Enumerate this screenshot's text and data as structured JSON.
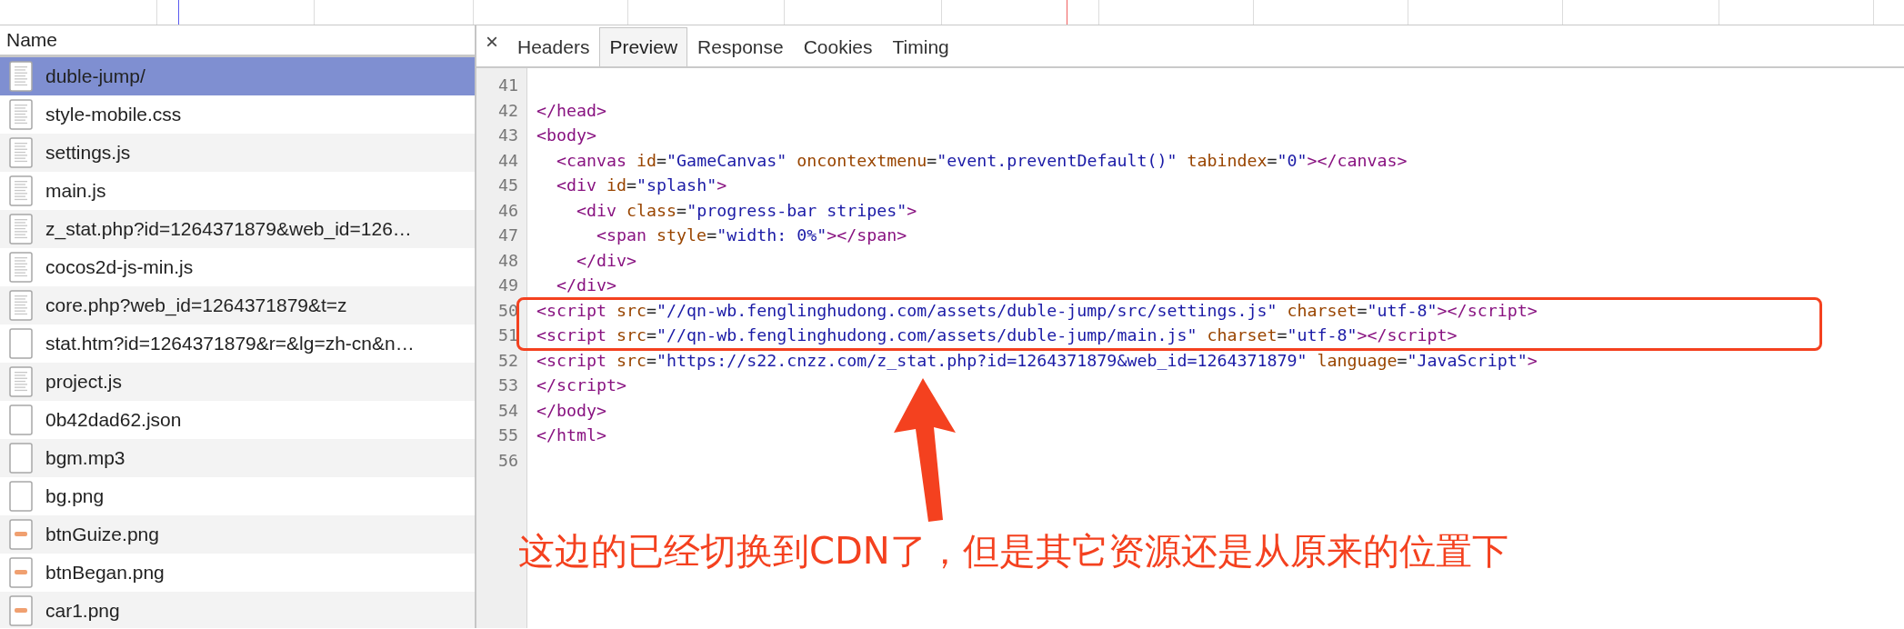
{
  "requests": {
    "column": "Name",
    "items": [
      {
        "name": "duble-jump/",
        "kind": "document",
        "selected": true
      },
      {
        "name": "style-mobile.css",
        "kind": "document",
        "selected": false
      },
      {
        "name": "settings.js",
        "kind": "document",
        "selected": false
      },
      {
        "name": "main.js",
        "kind": "document",
        "selected": false
      },
      {
        "name": "z_stat.php?id=1264371879&web_id=126…",
        "kind": "document",
        "selected": false
      },
      {
        "name": "cocos2d-js-min.js",
        "kind": "document",
        "selected": false
      },
      {
        "name": "core.php?web_id=1264371879&t=z",
        "kind": "document",
        "selected": false
      },
      {
        "name": "stat.htm?id=1264371879&r=&lg=zh-cn&n…",
        "kind": "blank",
        "selected": false
      },
      {
        "name": "project.js",
        "kind": "document",
        "selected": false
      },
      {
        "name": "0b42dad62.json",
        "kind": "blank",
        "selected": false
      },
      {
        "name": "bgm.mp3",
        "kind": "blank",
        "selected": false
      },
      {
        "name": "bg.png",
        "kind": "blank",
        "selected": false
      },
      {
        "name": "btnGuize.png",
        "kind": "image",
        "selected": false
      },
      {
        "name": "btnBegan.png",
        "kind": "image",
        "selected": false
      },
      {
        "name": "car1.png",
        "kind": "image",
        "selected": false
      }
    ]
  },
  "tabs": {
    "close": "×",
    "items": [
      {
        "label": "Headers",
        "selected": false
      },
      {
        "label": "Preview",
        "selected": true
      },
      {
        "label": "Response",
        "selected": false
      },
      {
        "label": "Cookies",
        "selected": false
      },
      {
        "label": "Timing",
        "selected": false
      }
    ]
  },
  "code_lines": [
    {
      "number": "41"
    },
    {
      "number": "42",
      "tokens": [
        {
          "kind": "tag",
          "text": "</head>"
        }
      ]
    },
    {
      "number": "43",
      "tokens": [
        {
          "kind": "tag",
          "text": "<body>"
        }
      ]
    },
    {
      "number": "44",
      "tokens": [
        {
          "kind": "tag",
          "text": "  <canvas"
        },
        {
          "kind": "attr",
          "text": " id"
        },
        {
          "kind": "plain",
          "text": "="
        },
        {
          "kind": "value",
          "text": "\"GameCanvas\""
        },
        {
          "kind": "attr",
          "text": " oncontextmenu"
        },
        {
          "kind": "plain",
          "text": "="
        },
        {
          "kind": "value",
          "text": "\"event.preventDefault()\""
        },
        {
          "kind": "attr",
          "text": " tabindex"
        },
        {
          "kind": "plain",
          "text": "="
        },
        {
          "kind": "value",
          "text": "\"0\""
        },
        {
          "kind": "tag",
          "text": "></canvas>"
        }
      ]
    },
    {
      "number": "45",
      "tokens": [
        {
          "kind": "tag",
          "text": "  <div"
        },
        {
          "kind": "attr",
          "text": " id"
        },
        {
          "kind": "plain",
          "text": "="
        },
        {
          "kind": "value",
          "text": "\"splash\""
        },
        {
          "kind": "tag",
          "text": ">"
        }
      ]
    },
    {
      "number": "46",
      "tokens": [
        {
          "kind": "tag",
          "text": "    <div"
        },
        {
          "kind": "attr",
          "text": " class"
        },
        {
          "kind": "plain",
          "text": "="
        },
        {
          "kind": "value",
          "text": "\"progress-bar stripes\""
        },
        {
          "kind": "tag",
          "text": ">"
        }
      ]
    },
    {
      "number": "47",
      "tokens": [
        {
          "kind": "tag",
          "text": "      <span"
        },
        {
          "kind": "attr",
          "text": " style"
        },
        {
          "kind": "plain",
          "text": "="
        },
        {
          "kind": "value",
          "text": "\"width: 0%\""
        },
        {
          "kind": "tag",
          "text": "></span>"
        }
      ]
    },
    {
      "number": "48",
      "tokens": [
        {
          "kind": "tag",
          "text": "    </div>"
        }
      ]
    },
    {
      "number": "49",
      "tokens": [
        {
          "kind": "tag",
          "text": "  </div>"
        }
      ]
    },
    {
      "number": "50",
      "tokens": [
        {
          "kind": "tag",
          "text": "<script"
        },
        {
          "kind": "attr",
          "text": " src"
        },
        {
          "kind": "plain",
          "text": "="
        },
        {
          "kind": "value",
          "text": "\"//qn-wb.fenglinghudong.com/assets/duble-jump/src/settings.js\""
        },
        {
          "kind": "attr",
          "text": " charset"
        },
        {
          "kind": "plain",
          "text": "="
        },
        {
          "kind": "value",
          "text": "\"utf-8\""
        },
        {
          "kind": "tag",
          "text": "></script>"
        }
      ]
    },
    {
      "number": "51",
      "tokens": [
        {
          "kind": "tag",
          "text": "<script"
        },
        {
          "kind": "attr",
          "text": " src"
        },
        {
          "kind": "plain",
          "text": "="
        },
        {
          "kind": "value",
          "text": "\"//qn-wb.fenglinghudong.com/assets/duble-jump/main.js\""
        },
        {
          "kind": "attr",
          "text": " charset"
        },
        {
          "kind": "plain",
          "text": "="
        },
        {
          "kind": "value",
          "text": "\"utf-8\""
        },
        {
          "kind": "tag",
          "text": "></script>"
        }
      ]
    },
    {
      "number": "52",
      "tokens": [
        {
          "kind": "tag",
          "text": "<script"
        },
        {
          "kind": "attr",
          "text": " src"
        },
        {
          "kind": "plain",
          "text": "="
        },
        {
          "kind": "value",
          "text": "\"https://s22.cnzz.com/z_stat.php?id=1264371879&web_id=1264371879\""
        },
        {
          "kind": "attr",
          "text": " language"
        },
        {
          "kind": "plain",
          "text": "="
        },
        {
          "kind": "value",
          "text": "\"JavaScript\""
        },
        {
          "kind": "tag",
          "text": ">"
        }
      ]
    },
    {
      "number": "53",
      "tokens": [
        {
          "kind": "tag",
          "text": "</script>"
        }
      ]
    },
    {
      "number": "54",
      "tokens": [
        {
          "kind": "tag",
          "text": "</body>"
        }
      ]
    },
    {
      "number": "55",
      "tokens": [
        {
          "kind": "tag",
          "text": "</html>"
        }
      ]
    },
    {
      "number": "56"
    }
  ],
  "annotation": {
    "text": "这边的已经切换到CDN了，但是其它资源还是从原来的位置下"
  }
}
